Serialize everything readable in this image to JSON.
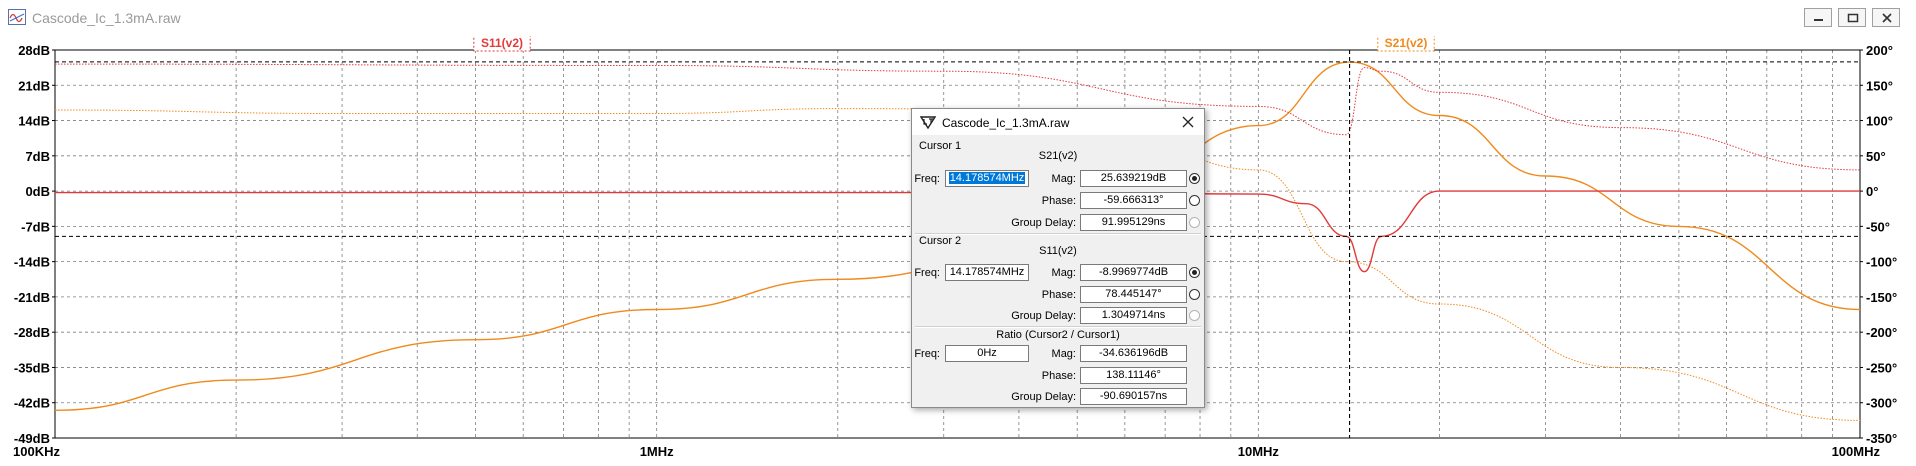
{
  "window": {
    "title": "Cascode_Ic_1.3mA.raw",
    "buttons": [
      "minimize",
      "restore",
      "close"
    ]
  },
  "plot": {
    "trace_labels": {
      "s11": "S11(v2)",
      "s21": "S21(v2)"
    },
    "left_axis_ticks": [
      "28dB",
      "21dB",
      "14dB",
      "7dB",
      "0dB",
      "-7dB",
      "-14dB",
      "-21dB",
      "-28dB",
      "-35dB",
      "-42dB",
      "-49dB"
    ],
    "right_axis_ticks": [
      "200°",
      "150°",
      "100°",
      "50°",
      "0°",
      "-50°",
      "-100°",
      "-150°",
      "-200°",
      "-250°",
      "-300°",
      "-350°"
    ],
    "x_axis_ticks": [
      "100KHz",
      "1MHz",
      "10MHz",
      "100MHz"
    ]
  },
  "colors": {
    "s11": "#e23a3a",
    "s21": "#f08a1c",
    "grid": "#7d7d7d",
    "cursor": "#000000"
  },
  "chart_data": {
    "type": "line",
    "x_scale": "log",
    "x_range_hz": [
      100000,
      100000000
    ],
    "ylim_db": [
      -49,
      28
    ],
    "ylim_deg": [
      -350,
      200
    ],
    "cursors": [
      {
        "freq_hz": 14178574,
        "db": 25.639219
      },
      {
        "freq_hz": 14178574,
        "db": -8.9969774
      }
    ],
    "series": [
      {
        "name": "S21(v2)",
        "type": "magnitude",
        "x": [
          100000,
          200000,
          500000,
          1000000,
          2000000,
          5000000,
          10000000,
          14178574,
          20000000,
          30000000,
          50000000,
          100000000
        ],
        "db": [
          -43.5,
          -37.5,
          -29.5,
          -23.5,
          -17.5,
          -9.5,
          13.0,
          25.6,
          15.0,
          3.0,
          -7.0,
          -23.5
        ]
      },
      {
        "name": "S21(v2)",
        "type": "phase",
        "x": [
          100000,
          300000,
          1000000,
          2000000,
          5000000,
          10000000,
          14000000,
          20000000,
          40000000,
          100000000
        ],
        "deg": [
          115,
          110,
          110,
          117,
          115,
          30,
          -100,
          -160,
          -250,
          -325
        ]
      },
      {
        "name": "S11(v2)",
        "type": "magnitude",
        "x": [
          100000,
          1000000,
          5000000,
          10000000,
          12000000,
          14000000,
          15000000,
          16000000,
          20000000,
          100000000
        ],
        "db": [
          -0.3,
          -0.3,
          -0.3,
          -0.6,
          -2.5,
          -9.0,
          -16.0,
          -9.0,
          0.0,
          0.0
        ]
      },
      {
        "name": "S11(v2)",
        "type": "phase",
        "x": [
          100000,
          1000000,
          3000000,
          10000000,
          14000000,
          15000000,
          16000000,
          20000000,
          40000000,
          100000000
        ],
        "deg": [
          180,
          178,
          170,
          120,
          80,
          175,
          170,
          140,
          90,
          30
        ]
      }
    ]
  },
  "dialog": {
    "title": "Cascode_Ic_1.3mA.raw",
    "cursor1": {
      "section": "Cursor 1",
      "trace": "S21(v2)",
      "freq_label": "Freq:",
      "freq": "14.178574MHz",
      "mag_label": "Mag:",
      "mag": "25.639219dB",
      "phase_label": "Phase:",
      "phase": "-59.666313°",
      "gd_label": "Group Delay:",
      "gd": "91.995129ns"
    },
    "cursor2": {
      "section": "Cursor 2",
      "trace": "S11(v2)",
      "freq_label": "Freq:",
      "freq": "14.178574MHz",
      "mag_label": "Mag:",
      "mag": "-8.9969774dB",
      "phase_label": "Phase:",
      "phase": "78.445147°",
      "gd_label": "Group Delay:",
      "gd": "1.3049714ns"
    },
    "ratio": {
      "section": "Ratio (Cursor2 / Cursor1)",
      "freq_label": "Freq:",
      "freq": "0Hz",
      "mag_label": "Mag:",
      "mag": "-34.636196dB",
      "phase_label": "Phase:",
      "phase": "138.11146°",
      "gd_label": "Group Delay:",
      "gd": "-90.690157ns"
    }
  }
}
